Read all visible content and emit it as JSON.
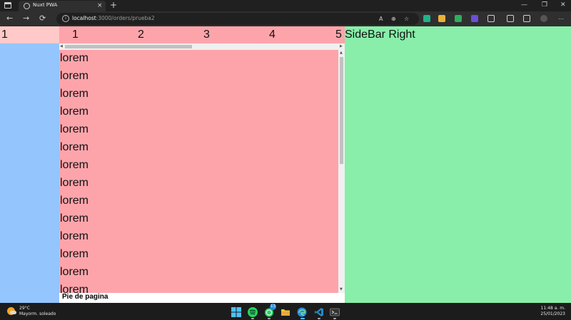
{
  "browser": {
    "tab_title": "Nuxt PWA",
    "tab_close": "×",
    "new_tab": "+",
    "controls": {
      "minimize": "—",
      "maximize": "❐",
      "close": "✕"
    },
    "nav": {
      "back": "←",
      "forward": "→",
      "refresh": "⟳"
    },
    "url_host": "localhost",
    "url_path": ":3000/orders/prueba2",
    "addr_icons": {
      "read_aloud": "A",
      "zoom": "⊕",
      "favorite": "☆"
    }
  },
  "page": {
    "sidebar_left_label": "1",
    "header_numbers": [
      "1",
      "2",
      "3",
      "4",
      "5"
    ],
    "content_items": [
      "lorem",
      "lorem",
      "lorem",
      "lorem",
      "lorem",
      "lorem",
      "lorem",
      "lorem",
      "lorem",
      "lorem",
      "lorem",
      "lorem",
      "lorem",
      "lorem"
    ],
    "footer_text": "Pie de pagina",
    "sidebar_right_label": "SideBar Right",
    "colors": {
      "sidebar_left_head": "#ffc9c9",
      "sidebar_left": "#95c5fd",
      "main": "#fda4ab",
      "sidebar_right": "#88eea9"
    }
  },
  "taskbar": {
    "weather_temp": "29°C",
    "weather_desc": "Mayorm. soleado",
    "whatsapp_badge": "13",
    "time": "11:48 a. m.",
    "date": "25/01/2023",
    "apps": [
      "windows-start-icon",
      "spotify-icon",
      "whatsapp-icon",
      "file-explorer-icon",
      "edge-icon",
      "vscode-icon",
      "terminal-icon"
    ]
  }
}
